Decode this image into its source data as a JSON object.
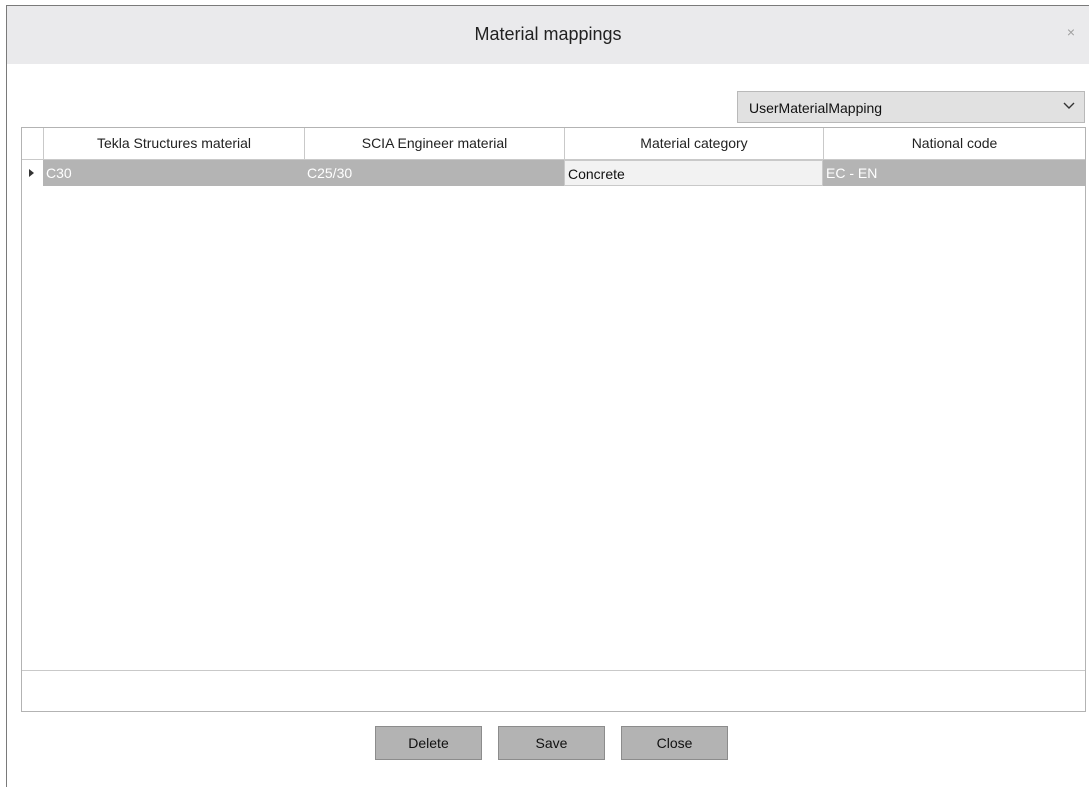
{
  "window": {
    "title": "Material mappings",
    "close_glyph": "×"
  },
  "mapping_select": {
    "value": "UserMaterialMapping",
    "icon": "chevron-down-icon"
  },
  "grid": {
    "columns": [
      "Tekla Structures material",
      "SCIA Engineer material",
      "Material category",
      "National code"
    ],
    "rows": [
      {
        "tekla": "C30",
        "scia": "C25/30",
        "category": "Concrete",
        "code": "EC - EN"
      }
    ]
  },
  "buttons": {
    "delete": "Delete",
    "save": "Save",
    "close": "Close"
  },
  "colors": {
    "selected_row": "#b4b4b4",
    "button": "#b3b3b3",
    "titlebar": "#eaeaec"
  }
}
